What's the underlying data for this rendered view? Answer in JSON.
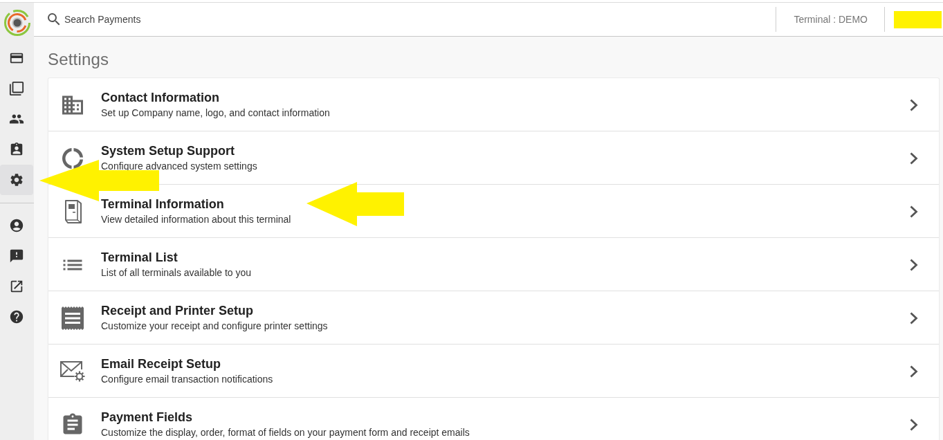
{
  "sidebar": {
    "groups": [
      [
        {
          "selected": false,
          "pointer_arrow": false
        },
        {
          "selected": false,
          "pointer_arrow": false
        },
        {
          "selected": false,
          "pointer_arrow": false
        },
        {
          "selected": false,
          "pointer_arrow": false
        },
        {
          "selected": true,
          "pointer_arrow": true
        }
      ],
      [
        {
          "selected": false,
          "pointer_arrow": false
        },
        {
          "selected": false,
          "pointer_arrow": false
        },
        {
          "selected": false,
          "pointer_arrow": false
        },
        {
          "selected": false,
          "pointer_arrow": false
        }
      ]
    ]
  },
  "header": {
    "search": {
      "placeholder": "Search Payments"
    },
    "terminal": "Terminal : DEMO",
    "name_redacted": true
  },
  "page_title": "Settings",
  "settings": [
    {
      "title": "Contact Information",
      "description": "Set up Company name, logo, and contact information",
      "pointer_arrow": false
    },
    {
      "title": "System Setup Support",
      "description": "Configure advanced system settings",
      "pointer_arrow": false
    },
    {
      "title": "Terminal Information",
      "description": "View detailed information about this terminal",
      "pointer_arrow": true
    },
    {
      "title": "Terminal List",
      "description": "List of all terminals available to you",
      "pointer_arrow": false
    },
    {
      "title": "Receipt and Printer Setup",
      "description": "Customize your receipt and configure printer settings",
      "pointer_arrow": false
    },
    {
      "title": "Email Receipt Setup",
      "description": "Configure email transaction notifications",
      "pointer_arrow": false
    },
    {
      "title": "Payment Fields",
      "description": "Customize the display, order, format of fields on your payment form and receipt emails",
      "pointer_arrow": false
    }
  ]
}
